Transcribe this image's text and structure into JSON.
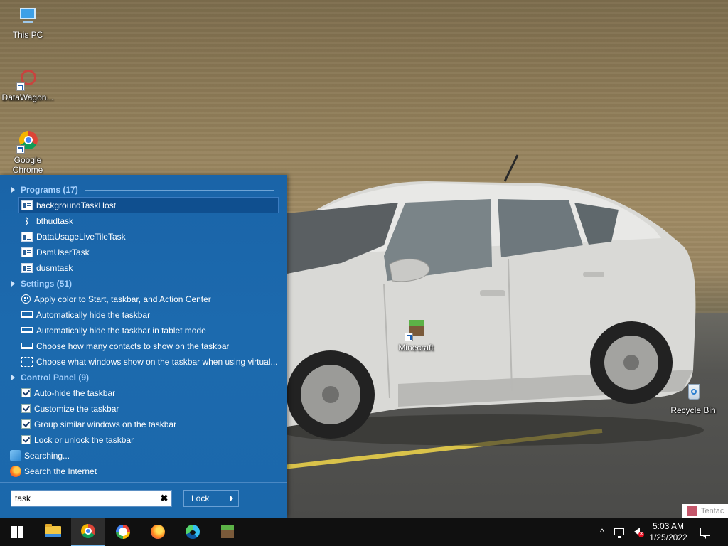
{
  "desktop": {
    "icons": [
      {
        "label": "This PC",
        "icon": "computer-icon"
      },
      {
        "label": "DataWagon...",
        "icon": "datawagon-icon"
      },
      {
        "label": "Google Chrome",
        "icon": "chrome-icon"
      },
      {
        "label": "Minecraft",
        "icon": "minecraft-icon"
      },
      {
        "label": "Recycle Bin",
        "icon": "recycle-bin-icon"
      }
    ]
  },
  "start_panel": {
    "groups": [
      {
        "header": "Programs (17)",
        "items": [
          {
            "label": "backgroundTaskHost",
            "icon": "app-icon",
            "selected": true
          },
          {
            "label": "bthudtask",
            "icon": "bluetooth-icon"
          },
          {
            "label": "DataUsageLiveTileTask",
            "icon": "app-icon"
          },
          {
            "label": "DsmUserTask",
            "icon": "app-icon"
          },
          {
            "label": "dusmtask",
            "icon": "app-icon"
          }
        ]
      },
      {
        "header": "Settings (51)",
        "items": [
          {
            "label": "Apply color to Start, taskbar, and Action Center",
            "icon": "palette-icon"
          },
          {
            "label": "Automatically hide the taskbar",
            "icon": "taskbar-icon"
          },
          {
            "label": "Automatically hide the taskbar in tablet mode",
            "icon": "taskbar-icon"
          },
          {
            "label": "Choose how many contacts to show on the taskbar",
            "icon": "taskbar-icon"
          },
          {
            "label": "Choose what windows show on the taskbar when using virtual...",
            "icon": "virtual-desktop-icon"
          }
        ]
      },
      {
        "header": "Control Panel (9)",
        "items": [
          {
            "label": "Auto-hide the taskbar",
            "icon": "checkbox-icon"
          },
          {
            "label": "Customize the taskbar",
            "icon": "checkbox-icon"
          },
          {
            "label": "Group similar windows on the taskbar",
            "icon": "checkbox-icon"
          },
          {
            "label": "Lock or unlock the taskbar",
            "icon": "checkbox-icon"
          }
        ]
      }
    ],
    "searching_label": "Searching...",
    "search_internet_label": "Search the Internet",
    "search_value": "task",
    "clear_glyph": "✖",
    "lock_label": "Lock"
  },
  "notification_preview": {
    "text": "Tentac"
  },
  "taskbar": {
    "pinned": [
      {
        "name": "file-explorer",
        "icon": "folder-icon"
      },
      {
        "name": "google-chrome",
        "icon": "chrome-icon",
        "active": true
      },
      {
        "name": "browser",
        "icon": "shield-browser-icon"
      },
      {
        "name": "firefox",
        "icon": "firefox-icon"
      },
      {
        "name": "edge",
        "icon": "edge-icon"
      },
      {
        "name": "minecraft",
        "icon": "minecraft-icon"
      }
    ],
    "tray_chevron": "^",
    "clock_time": "5:03 AM",
    "clock_date": "1/25/2022",
    "volume_muted_glyph": "✕"
  }
}
